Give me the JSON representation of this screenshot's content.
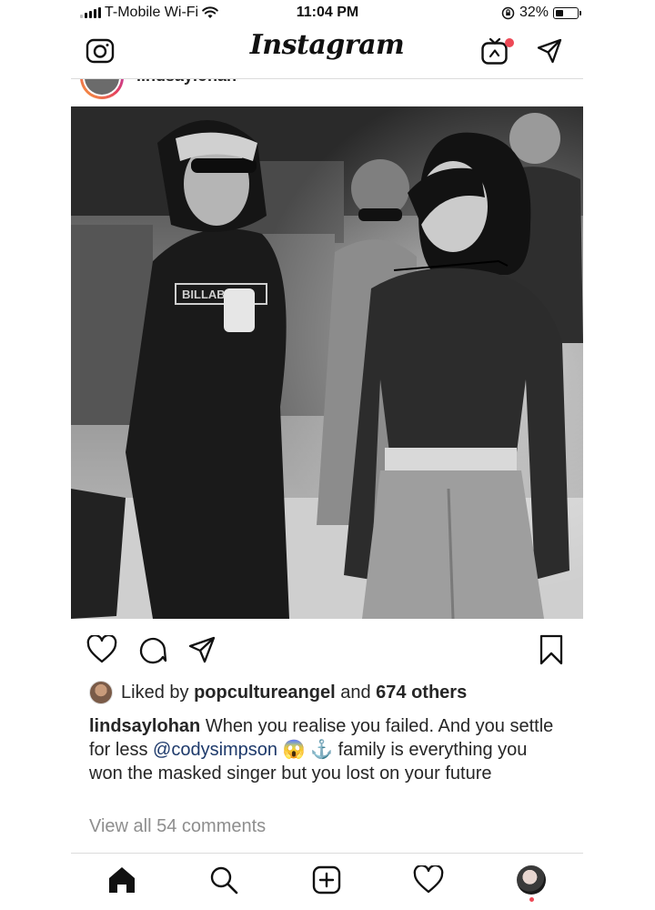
{
  "status_bar": {
    "carrier": "T-Mobile Wi-Fi",
    "time": "11:04 PM",
    "battery": "32%",
    "battery_level": 0.32
  },
  "nav": {
    "brand": "Instagram",
    "icons": [
      "camera-icon",
      "igtv-icon",
      "direct-message-icon"
    ]
  },
  "post": {
    "username": "lindsaylohan",
    "likes": {
      "prefix": "Liked by",
      "user": "popcultureangel",
      "joiner": "and",
      "others": "674 others"
    },
    "caption": {
      "username": "lindsaylohan",
      "text_1": "When you realise you failed. And you settle for less",
      "mention": "@codysimpson",
      "emoji_1": "😱",
      "emoji_2": "⚓",
      "text_2": "family is everything you won the masked singer but you lost on your future"
    },
    "view_all_comments": "View all 54 comments"
  },
  "tabbar": {
    "icons": [
      "home-icon",
      "search-icon",
      "new-post-icon",
      "activity-heart-icon",
      "profile-avatar"
    ]
  },
  "colors": {
    "notification": "#ed4956",
    "mention": "#1e3a6b",
    "muted": "#8e8e8e",
    "divider": "#dbdbdb"
  }
}
